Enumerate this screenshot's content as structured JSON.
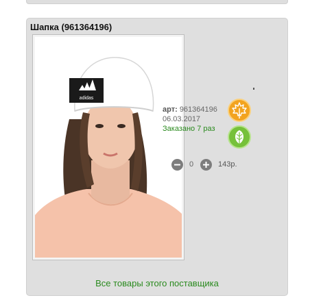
{
  "product": {
    "title": "Шапка (961364196)",
    "article_label": "арт:",
    "article_number": "961364196",
    "date": "06.03.2017",
    "ordered_text": "Заказано 7 раз",
    "quantity": "0",
    "price": "143р.",
    "hat_logo_text": "adidas"
  },
  "badges": {
    "first_icon": "maple-leaf-icon",
    "second_icon": "green-leaf-icon"
  },
  "footer": {
    "supplier_link": "Все товары этого поставщика"
  },
  "colors": {
    "ordered_green": "#2a8a1e",
    "badge_orange": "#f2a31f",
    "badge_green": "#76c13a",
    "card_bg": "#dfdfdf"
  }
}
